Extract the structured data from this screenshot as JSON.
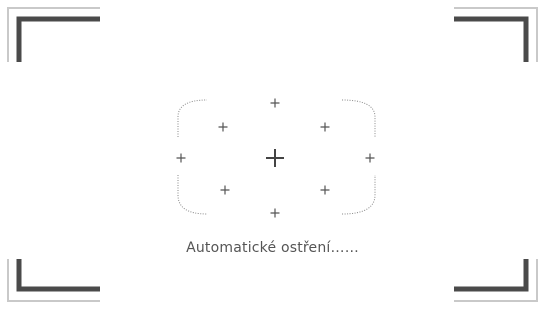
{
  "status": {
    "message": "Automatické ostření……"
  },
  "colors": {
    "background": "#ffffff",
    "bracket_dark": "#4a4a4a",
    "bracket_light": "#c9c9c9",
    "reticle": "#555555",
    "focus_frame": "#888888"
  },
  "icons": {
    "corner_brackets": "corner-bracket-icon",
    "af_points": "plus-icon",
    "center_point": "plus-icon"
  }
}
